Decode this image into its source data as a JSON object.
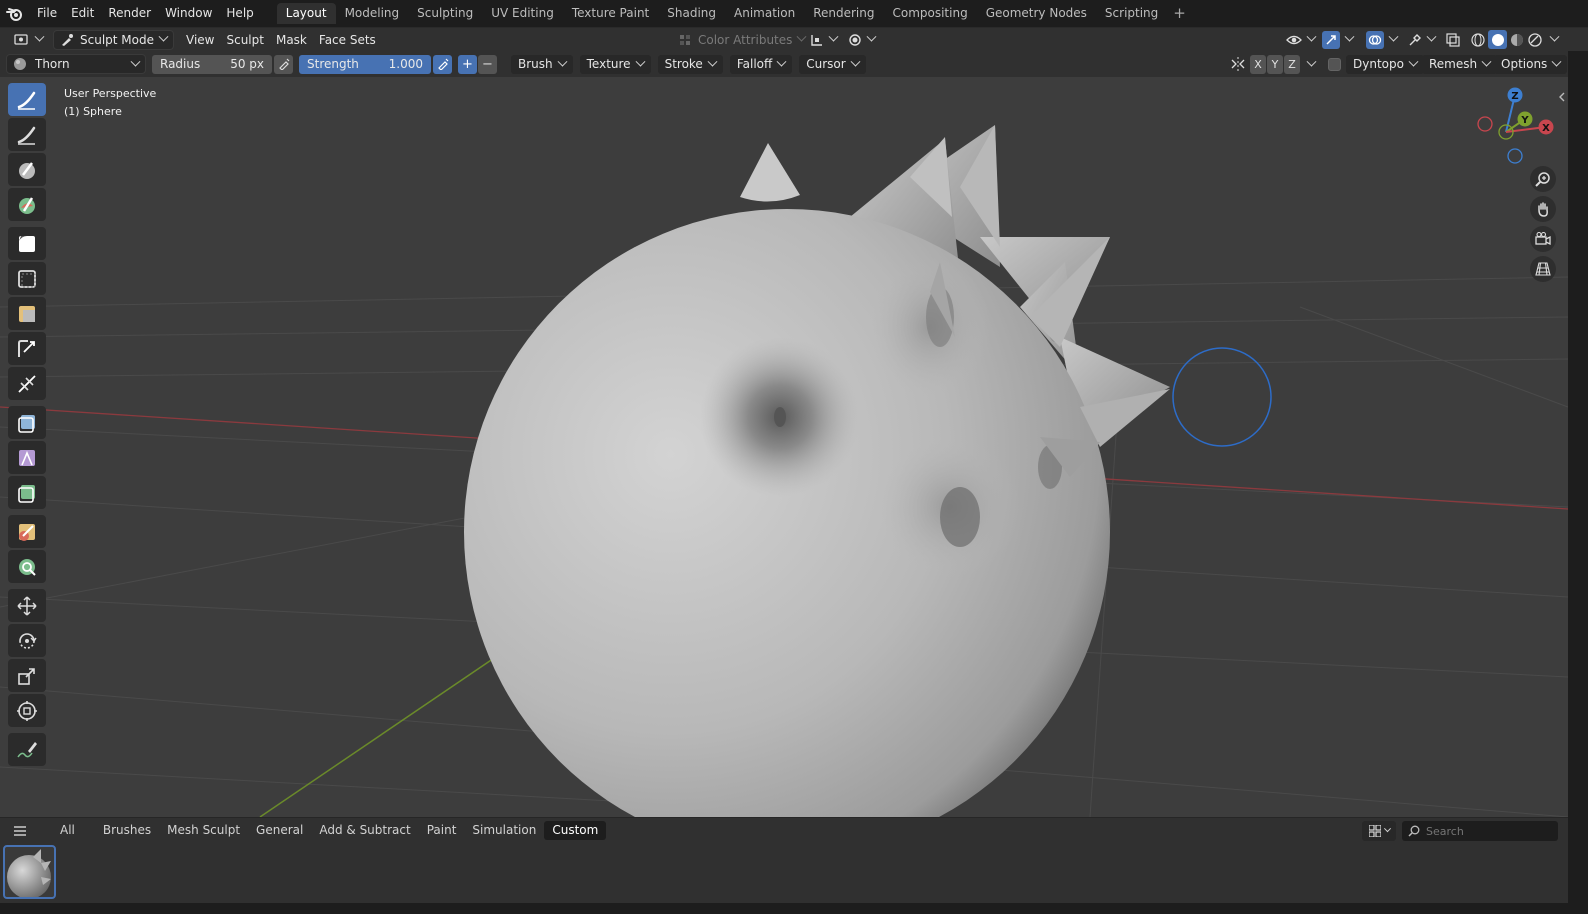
{
  "menu": {
    "items": [
      "File",
      "Edit",
      "Render",
      "Window",
      "Help"
    ]
  },
  "workspaces": {
    "tabs": [
      "Layout",
      "Modeling",
      "Sculpting",
      "UV Editing",
      "Texture Paint",
      "Shading",
      "Animation",
      "Rendering",
      "Compositing",
      "Geometry Nodes",
      "Scripting"
    ],
    "active": "Layout"
  },
  "header": {
    "mode": "Sculpt Mode",
    "menus": [
      "View",
      "Sculpt",
      "Mask",
      "Face Sets"
    ],
    "color_attributes": "Color Attributes"
  },
  "tool_settings": {
    "brush_name": "Thorn",
    "radius_label": "Radius",
    "radius_value": "50 px",
    "strength_label": "Strength",
    "strength_value": "1.000",
    "add_symbol": "+",
    "subtract_symbol": "−",
    "dropdowns": [
      "Brush",
      "Texture",
      "Stroke",
      "Falloff",
      "Cursor"
    ],
    "axes": [
      "X",
      "Y",
      "Z"
    ],
    "dyntopo": "Dyntopo",
    "remesh": "Remesh",
    "options": "Options"
  },
  "viewport": {
    "perspective": "User Perspective",
    "object": "(1) Sphere",
    "gizmo": {
      "z": "Z",
      "y": "Y",
      "x": "X"
    }
  },
  "toolbar_icons": [
    "draw-sharp-icon",
    "draw-icon",
    "clay-strips-icon",
    "paint-icon",
    "mask-icon",
    "box-mask-icon",
    "face-set-icon",
    "trim-icon",
    "line-project-icon",
    "mesh-filter-icon",
    "cloth-filter-icon",
    "color-filter-icon",
    "edit-face-set-icon",
    "mask-by-color-icon",
    "move-icon",
    "rotate-icon",
    "scale-icon",
    "transform-icon",
    "annotate-icon"
  ],
  "asset_shelf": {
    "categories": [
      "All",
      "Brushes",
      "Mesh Sculpt",
      "General",
      "Add & Subtract",
      "Paint",
      "Simulation",
      "Custom"
    ],
    "active": "Custom",
    "search_placeholder": "Search"
  },
  "colors": {
    "accent": "#4772b3",
    "background": "#3d3d3d",
    "axis_x": "#c8464e",
    "axis_y": "#7fa12e",
    "axis_z": "#3d7fd1"
  }
}
